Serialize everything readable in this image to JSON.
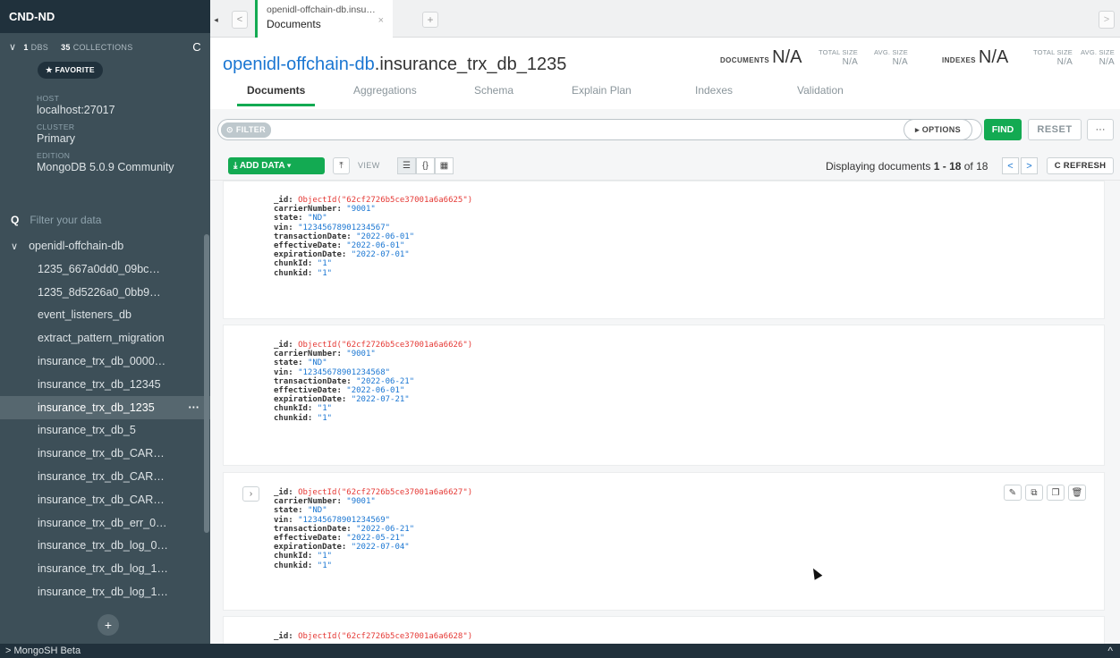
{
  "sidebar": {
    "instance_name": "CND-ND",
    "dbs_count": "1",
    "dbs_label": "DBS",
    "collections_count": "35",
    "collections_label": "COLLECTIONS",
    "favorite_label": "★ FAVORITE",
    "host_label": "HOST",
    "host_value": "localhost:27017",
    "cluster_label": "CLUSTER",
    "cluster_value": "Primary",
    "edition_label": "EDITION",
    "edition_value": "MongoDB 5.0.9 Community",
    "filter_placeholder": "Filter your data",
    "database": "openidl-offchain-db",
    "collections": [
      "1235_667a0dd0_09bc…",
      "1235_8d5226a0_0bb9…",
      "event_listeners_db",
      "extract_pattern_migration",
      "insurance_trx_db_0000…",
      "insurance_trx_db_12345",
      "insurance_trx_db_1235",
      "insurance_trx_db_5",
      "insurance_trx_db_CAR…",
      "insurance_trx_db_CAR…",
      "insurance_trx_db_CAR…",
      "insurance_trx_db_err_0…",
      "insurance_trx_db_log_0…",
      "insurance_trx_db_log_1…",
      "insurance_trx_db_log_1…"
    ],
    "active_collection_index": 6,
    "add_label": "+"
  },
  "shell": {
    "label": "> MongoSH Beta",
    "caret": "^"
  },
  "tabbar": {
    "tab_title": "openidl-offchain-db.insu…",
    "tab_subtitle": "Documents",
    "close": "×",
    "new_tab": "+"
  },
  "header": {
    "db_name": "openidl-offchain-db",
    "coll_name": ".insurance_trx_db_1235",
    "documents_label": "DOCUMENTS",
    "documents_value": "N/A",
    "indexes_label": "INDEXES",
    "indexes_value": "N/A",
    "total_size_label": "TOTAL SIZE",
    "avg_size_label": "AVG. SIZE",
    "na": "N/A"
  },
  "subtabs": [
    "Documents",
    "Aggregations",
    "Schema",
    "Explain Plan",
    "Indexes",
    "Validation"
  ],
  "query": {
    "filter_label": "⊙ FILTER",
    "options_label": "▸ OPTIONS",
    "find_label": "FIND",
    "reset_label": "RESET",
    "more_label": "···",
    "add_data_label": "⤓ ADD DATA ▾",
    "view_label": "VIEW",
    "pager_prefix": "Displaying documents ",
    "pager_range": "1 - 18",
    "pager_suffix": " of 18",
    "refresh_label": "C REFRESH"
  },
  "documents": [
    {
      "_id": "ObjectId(\"62cf2726b5ce37001a6a6625\")",
      "carrierNumber": "\"9001\"",
      "state": "\"ND\"",
      "vin": "\"12345678901234567\"",
      "transactionDate": "\"2022-06-01\"",
      "effectiveDate": "\"2022-06-01\"",
      "expirationDate": "\"2022-07-01\"",
      "chunkId": "\"1\"",
      "chunkid": "\"1\""
    },
    {
      "_id": "ObjectId(\"62cf2726b5ce37001a6a6626\")",
      "carrierNumber": "\"9001\"",
      "state": "\"ND\"",
      "vin": "\"12345678901234568\"",
      "transactionDate": "\"2022-06-21\"",
      "effectiveDate": "\"2022-06-01\"",
      "expirationDate": "\"2022-07-21\"",
      "chunkId": "\"1\"",
      "chunkid": "\"1\""
    },
    {
      "_id": "ObjectId(\"62cf2726b5ce37001a6a6627\")",
      "carrierNumber": "\"9001\"",
      "state": "\"ND\"",
      "vin": "\"12345678901234569\"",
      "transactionDate": "\"2022-06-21\"",
      "effectiveDate": "\"2022-05-21\"",
      "expirationDate": "\"2022-07-04\"",
      "chunkId": "\"1\"",
      "chunkid": "\"1\""
    },
    {
      "_id": "ObjectId(\"62cf2726b5ce37001a6a6628\")"
    }
  ],
  "colors": {
    "accent": "#13aa52",
    "link": "#1a76d2",
    "oid": "#e53935",
    "sidebar": "#3d4f58"
  }
}
